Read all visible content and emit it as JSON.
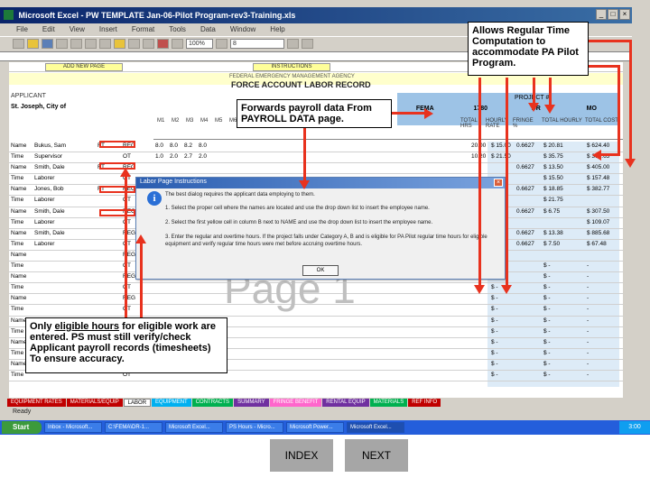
{
  "window": {
    "title": "Microsoft Excel - PW TEMPLATE Jan-06-Pilot Program-rev3-Training.xls",
    "controls": [
      "_",
      "□",
      "×"
    ]
  },
  "menu": [
    "File",
    "Edit",
    "View",
    "Insert",
    "Format",
    "Tools",
    "Data",
    "Window",
    "Help"
  ],
  "toolbar": {
    "zoom": "100%",
    "font_size": "8"
  },
  "sheet": {
    "nav_buttons": [
      "ADD NEW PAGE",
      "INSTRUCTIONS"
    ],
    "agency": "FEDERAL EMERGENCY MANAGEMENT AGENCY",
    "form_title": "FORCE ACCOUNT LABOR RECORD",
    "applicant_label": "APPLICANT",
    "applicant_value": "St. Joseph, City of",
    "project_row": [
      "FEMA",
      "1780",
      "DR",
      "MO"
    ],
    "project_label": "PROJECT #",
    "col_headings": [
      "M1",
      "M2",
      "M3",
      "M4",
      "M5",
      "M6",
      "M7",
      "TOTAL HRS",
      "HOURLY RATE",
      "FRINGE %",
      "TOTAL HOURLY",
      "TOTAL COST"
    ],
    "rows": [
      {
        "type": "Name",
        "name": "Bukus, Sam",
        "ft": "FT",
        "code": "REG",
        "h1": "8.0",
        "h2": "8.0",
        "h3": "8.2",
        "h4": "8.0",
        "hrs": "20.00",
        "rate": "$ 15.00",
        "fringe": "0.6627",
        "total_hourly": "$ 20.81",
        "total_cost": "$ 624.40"
      },
      {
        "type": "Time",
        "name": "Supervisor",
        "ft": "",
        "code": "OT",
        "h1": "1.0",
        "h2": "2.0",
        "h3": "2.7",
        "h4": "2.0",
        "hrs": "10.20",
        "rate": "$ 21.50",
        "fringe": "",
        "total_hourly": "$ 35.75",
        "total_cost": "$ 364.65"
      },
      {
        "type": "Name",
        "name": "Smith, Dale",
        "ft": "FT",
        "code": "REG",
        "h1": "",
        "h2": "",
        "h3": "",
        "h4": "",
        "hrs": "",
        "rate": "",
        "fringe": "0.6627",
        "total_hourly": "$ 13.50",
        "total_cost": "$ 405.00"
      },
      {
        "type": "Time",
        "name": "Laborer",
        "ft": "",
        "code": "OT",
        "h1": "",
        "h2": "",
        "h3": "",
        "h4": "",
        "hrs": "",
        "rate": "",
        "fringe": "",
        "total_hourly": "$ 15.50",
        "total_cost": "$ 157.48"
      },
      {
        "type": "Name",
        "name": "Jones, Bob",
        "ft": "FT",
        "code": "REG",
        "h1": "",
        "h2": "",
        "h3": "",
        "h4": "",
        "hrs": "",
        "rate": "",
        "fringe": "0.6627",
        "total_hourly": "$ 18.85",
        "total_cost": "$ 382.77"
      },
      {
        "type": "Time",
        "name": "Laborer",
        "ft": "",
        "code": "OT",
        "h1": "",
        "h2": "",
        "h3": "",
        "h4": "",
        "hrs": "",
        "rate": "",
        "fringe": "",
        "total_hourly": "$ 21.75",
        "total_cost": ""
      },
      {
        "type": "Name",
        "name": "Smith, Dale",
        "ft": "",
        "code": "REG",
        "h1": "",
        "h2": "",
        "h3": "",
        "h4": "",
        "hrs": "",
        "rate": "",
        "fringe": "0.6627",
        "total_hourly": "$ 6.75",
        "total_cost": "$ 307.50"
      },
      {
        "type": "Time",
        "name": "Laborer",
        "ft": "",
        "code": "OT",
        "h1": "",
        "h2": "",
        "h3": "",
        "h4": "",
        "hrs": "",
        "rate": "",
        "fringe": "",
        "total_hourly": "",
        "total_cost": "$ 109.07"
      },
      {
        "type": "Name",
        "name": "Smith, Dale",
        "ft": "",
        "code": "REG",
        "h1": "",
        "h2": "",
        "h3": "",
        "h4": "",
        "hrs": "",
        "rate": "",
        "fringe": "0.6627",
        "total_hourly": "$ 13.38",
        "total_cost": "$ 885.68"
      },
      {
        "type": "Time",
        "name": "Laborer",
        "ft": "",
        "code": "OT",
        "h1": "",
        "h2": "",
        "h3": "",
        "h4": "",
        "hrs": "",
        "rate": "",
        "fringe": "0.6627",
        "total_hourly": "$ 7.50",
        "total_cost": "$ 67.48"
      },
      {
        "type": "Name",
        "name": "",
        "ft": "",
        "code": "REG",
        "h1": "",
        "h2": "",
        "h3": "",
        "h4": "",
        "hrs": "",
        "rate": "",
        "fringe": "",
        "total_hourly": "",
        "total_cost": ""
      },
      {
        "type": "Time",
        "name": "",
        "ft": "",
        "code": "OT",
        "h1": "",
        "h2": "",
        "h3": "",
        "h4": "",
        "hrs": "",
        "rate": "$ -",
        "fringe": "",
        "total_hourly": "$ -",
        "total_cost": "-"
      },
      {
        "type": "Name",
        "name": "",
        "ft": "",
        "code": "REG",
        "h1": "",
        "h2": "",
        "h3": "",
        "h4": "",
        "hrs": "",
        "rate": "$ -",
        "fringe": "",
        "total_hourly": "$ -",
        "total_cost": "-"
      },
      {
        "type": "Time",
        "name": "",
        "ft": "",
        "code": "OT",
        "h1": "",
        "h2": "",
        "h3": "",
        "h4": "",
        "hrs": "",
        "rate": "$ -",
        "fringe": "",
        "total_hourly": "$ -",
        "total_cost": "-"
      },
      {
        "type": "Name",
        "name": "",
        "ft": "",
        "code": "REG",
        "h1": "",
        "h2": "",
        "h3": "",
        "h4": "",
        "hrs": "",
        "rate": "$ -",
        "fringe": "",
        "total_hourly": "$ -",
        "total_cost": "-"
      },
      {
        "type": "Time",
        "name": "",
        "ft": "",
        "code": "OT",
        "h1": "",
        "h2": "",
        "h3": "",
        "h4": "",
        "hrs": "",
        "rate": "$ -",
        "fringe": "",
        "total_hourly": "$ -",
        "total_cost": "-"
      },
      {
        "type": "Name",
        "name": "",
        "ft": "",
        "code": "REG",
        "h1": "",
        "h2": "",
        "h3": "",
        "h4": "",
        "hrs": "",
        "rate": "$ -",
        "fringe": "",
        "total_hourly": "$ -",
        "total_cost": "-"
      },
      {
        "type": "Time",
        "name": "",
        "ft": "",
        "code": "OT",
        "h1": "",
        "h2": "",
        "h3": "",
        "h4": "",
        "hrs": "",
        "rate": "$ -",
        "fringe": "",
        "total_hourly": "$ -",
        "total_cost": "-"
      },
      {
        "type": "Name",
        "name": "",
        "ft": "",
        "code": "REG",
        "h1": "",
        "h2": "",
        "h3": "",
        "h4": "",
        "hrs": "",
        "rate": "$ -",
        "fringe": "",
        "total_hourly": "$ -",
        "total_cost": "-"
      },
      {
        "type": "Time",
        "name": "",
        "ft": "",
        "code": "OT",
        "h1": "",
        "h2": "",
        "h3": "",
        "h4": "",
        "hrs": "",
        "rate": "$ -",
        "fringe": "",
        "total_hourly": "$ -",
        "total_cost": "-"
      },
      {
        "type": "Name",
        "name": "",
        "ft": "",
        "code": "REG",
        "h1": "",
        "h2": "",
        "h3": "",
        "h4": "",
        "hrs": "",
        "rate": "$ -",
        "fringe": "",
        "total_hourly": "$ -",
        "total_cost": "-"
      },
      {
        "type": "Time",
        "name": "",
        "ft": "",
        "code": "OT",
        "h1": "",
        "h2": "",
        "h3": "",
        "h4": "",
        "hrs": "",
        "rate": "$ -",
        "fringe": "",
        "total_hourly": "$ -",
        "total_cost": "-"
      }
    ],
    "watermark": "Page 1"
  },
  "sheet_tabs": [
    {
      "label": "EQUIPMENT RATES",
      "color": "#c00000"
    },
    {
      "label": "MATERIALS/EQUIP",
      "color": "#c00000"
    },
    {
      "label": "LABOR",
      "color": "#ffffff"
    },
    {
      "label": "EQUIPMENT",
      "color": "#00b0f0"
    },
    {
      "label": "CONTRACTS",
      "color": "#00b050"
    },
    {
      "label": "SUMMARY",
      "color": "#7030a0"
    },
    {
      "label": "FRINGE BENEFIT",
      "color": "#ff66cc"
    },
    {
      "label": "RENTAL EQUIP",
      "color": "#7030a0"
    },
    {
      "label": "MATERIALS",
      "color": "#00b050"
    },
    {
      "label": "REF INFO",
      "color": "#c00000"
    }
  ],
  "statusbar": {
    "text": "Ready"
  },
  "taskbar": {
    "start": "Start",
    "tasks": [
      "Inbox - Microsoft...",
      "C:\\FEMA\\DR-1...",
      "Microsoft Excel...",
      "PS Hours - Micro...",
      "Microsoft Power...",
      "Microsoft Excel..."
    ],
    "active_index": 5,
    "clock": "3:00"
  },
  "dialog": {
    "title": "Labor Page Instructions",
    "line1": "The best dialog requires the applicant data employing to them.",
    "line2": "1.  Select the proper cell where the names are located and use the drop down list to insert the employee name.",
    "line3": "2.  Select the first yellow cell in column B next to NAME and use the drop down list to insert the employee name.",
    "line4": "3.  Enter the regular and overtime hours. If the project falls under Category A, B and is eligible for PA Pilot regular time hours for eligible equipment and verify regular time hours were met before accruing overtime hours.",
    "ok_label": "OK"
  },
  "callouts": {
    "top_right": "Allows Regular Time Computation to accommodate PA Pilot Program.",
    "payroll": "Forwards payroll data From PAYROLL DATA page.",
    "eligible_pre": "Only ",
    "eligible_underlined": "eligible hours",
    "eligible_post": " for eligible work are entered.  PS must still verify/check Applicant payroll records (timesheets) To ensure accuracy."
  },
  "slide_nav": {
    "index_label": "INDEX",
    "next_label": "NEXT"
  },
  "colors": {
    "accent_red": "#e8321e",
    "excel_blue": "#0a246a",
    "total_blue": "#9dc3e6",
    "slide_button": "#a6a6a6"
  }
}
